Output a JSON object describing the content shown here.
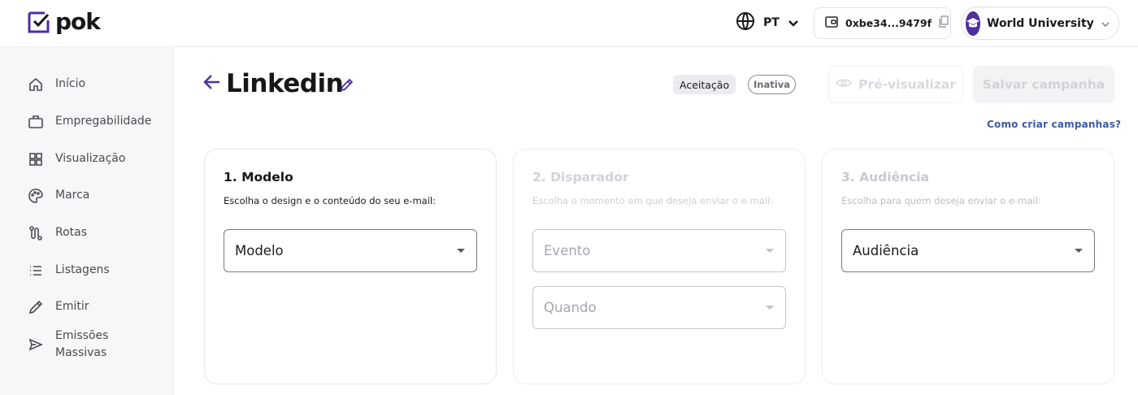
{
  "brand": {
    "name": "pok",
    "accent": "#4d2ea3"
  },
  "header": {
    "language": "PT",
    "wallet_address": "0xbe34...9479f",
    "organization": "World University"
  },
  "sidebar": {
    "items": [
      {
        "label": "Início",
        "icon": "home-icon"
      },
      {
        "label": "Empregabilidade",
        "icon": "briefcase-icon"
      },
      {
        "label": "Visualização",
        "icon": "grid-icon"
      },
      {
        "label": "Marca",
        "icon": "palette-icon"
      },
      {
        "label": "Rotas",
        "icon": "route-icon"
      },
      {
        "label": "Listagens",
        "icon": "list-icon"
      },
      {
        "label": "Emitir",
        "icon": "pencil-icon"
      },
      {
        "label": "Emissões Massivas",
        "icon": "send-icon"
      }
    ]
  },
  "page": {
    "title": "Linkedin",
    "type_badge": "Aceitação",
    "status_badge": "Inativa",
    "preview_label": "Pré-visualizar",
    "save_label": "Salvar campanha",
    "help_link": "Como criar campanhas?"
  },
  "steps": [
    {
      "title": "1. Modelo",
      "subtitle": "Escolha o design e o conteúdo do seu e-mail:",
      "selects": [
        "Modelo"
      ]
    },
    {
      "title": "2. Disparador",
      "subtitle": "Escolha o momento em que deseja enviar o e-mail:",
      "selects": [
        "Evento",
        "Quando"
      ]
    },
    {
      "title": "3. Audiência",
      "subtitle": "Escolha para quem deseja enviar o e-mail:",
      "selects": [
        "Audiência"
      ]
    }
  ]
}
